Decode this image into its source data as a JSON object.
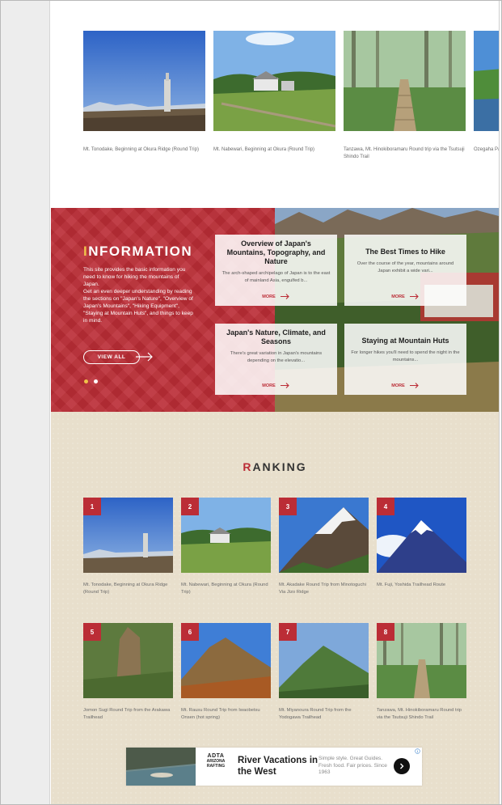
{
  "colors": {
    "brand_red": "#bb2d36",
    "accent_gold": "#f0c24a",
    "ranking_bg": "#e8dfcc",
    "gutter": "#ededed"
  },
  "top_strip": {
    "cards": [
      {
        "caption": "Mt. Tonodake, Beginning at Okura Ridge (Round Trip)",
        "photo": "summit-monument"
      },
      {
        "caption": "Mt. Nabewari, Beginning at Okura (Round Trip)",
        "photo": "mountain-hut"
      },
      {
        "caption": "Tanzawa, Mt. Hinokiboramaru Round trip via the Tsutsuji Shindo Trail",
        "photo": "forest-boardwalk"
      },
      {
        "caption": "Ozegaha Pass",
        "photo": "wetland"
      }
    ]
  },
  "information": {
    "title_first": "I",
    "title_rest": "NFORMATION",
    "description_1": "This site provides the basic information you need to know for hiking the mountains of Japan.",
    "description_2": "Get an even deeper understanding by reading the sections on \"Japan's Nature\", \"Overview of Japan's Mountains\", \"Hiking Equipment\", \"Staying at Mountain Huts\", and things to keep in mind.",
    "view_all_label": "VIEW ALL",
    "slides_total": 2,
    "slide_active": 1,
    "cards": [
      {
        "title": "Overview of Japan's Mountains, Topography, and Nature",
        "excerpt": "The arch-shaped archipelago of Japan is to the east of mainland Asia, engulfed b...",
        "more": "MORE"
      },
      {
        "title": "The Best Times to Hike",
        "excerpt": "Over the course of the year, mountains around Japan exhibit a wide vari...",
        "more": "MORE"
      },
      {
        "title": "Japan's Nature, Climate, and Seasons",
        "excerpt": "There's great variation in Japan's mountains depending on the elevatio...",
        "more": "MORE"
      },
      {
        "title": "Staying at Mountain Huts",
        "excerpt": "For longer hikes you'll need to spend the night in the mountains...",
        "more": "MORE"
      }
    ]
  },
  "ranking": {
    "title_first": "R",
    "title_rest": "ANKING",
    "items": [
      {
        "rank": "1",
        "caption": "Mt. Tonodake, Beginning at Okura Ridge (Round Trip)",
        "photo": "summit-monument"
      },
      {
        "rank": "2",
        "caption": "Mt. Nabewari, Beginning at Okura (Round Trip)",
        "photo": "mountain-hut"
      },
      {
        "rank": "3",
        "caption": "Mt. Akadake Round Trip from Minotoguchi Via Jizo Ridge",
        "photo": "snow-ridge"
      },
      {
        "rank": "4",
        "caption": "Mt. Fuji, Yoshida Trailhead Route",
        "photo": "fuji"
      },
      {
        "rank": "5",
        "caption": "Jomon Sugi Round Trip from the Arakawa Trailhead",
        "photo": "cedar"
      },
      {
        "rank": "6",
        "caption": "Mt. Rausu Round Trip from Iwaobetsu Onsen (hot spring)",
        "photo": "autumn-peak"
      },
      {
        "rank": "7",
        "caption": "Mt. Miyanoura Round Trip from the Yodogawa Trailhead",
        "photo": "green-peak"
      },
      {
        "rank": "8",
        "caption": "Tanzawa, Mt. Hinokiboramaru Round trip via the Tsutsuji Shindo Trail",
        "photo": "forest-boardwalk"
      }
    ]
  },
  "ad": {
    "logo_top": "ADTA",
    "logo_mid": "ARIZONA",
    "logo_bottom": "RAFTING",
    "headline": "River Vacations in the West",
    "subtext": "Simple style. Great Guides. Fresh food. Fair prices. Since 1963",
    "icons": {
      "go": "chevron-right-icon",
      "info": "ad-info-icon"
    }
  }
}
